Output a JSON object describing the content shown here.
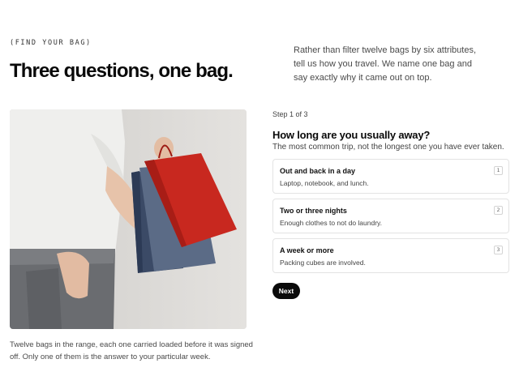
{
  "header": {
    "eyebrow": "(FIND YOUR BAG)",
    "title": "Three questions, one bag.",
    "intro": "Rather than filter twelve bags by six attributes, tell us how you travel. We name one bag and say exactly why it came out on top."
  },
  "photo": {
    "caption": "Twelve bags in the range, each one carried loaded before it was signed off. Only one of them is the answer to your particular week."
  },
  "quiz": {
    "step": "Step 1 of 3",
    "question": "How long are you usually away?",
    "subtext": "The most common trip, not the longest one you have ever taken.",
    "options": [
      {
        "title": "Out and back in a day",
        "desc": "Laptop, notebook, and lunch.",
        "key": "1"
      },
      {
        "title": "Two or three nights",
        "desc": "Enough clothes to not do laundry.",
        "key": "2"
      },
      {
        "title": "A week or more",
        "desc": "Packing cubes are involved.",
        "key": "3"
      }
    ],
    "next_label": "Next"
  }
}
